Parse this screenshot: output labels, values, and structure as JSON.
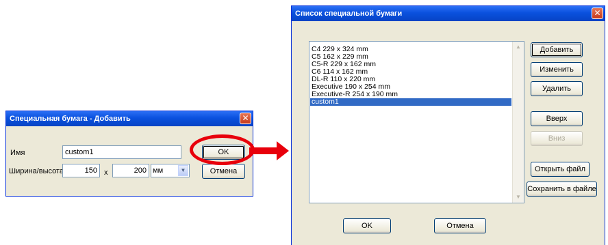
{
  "add_dialog": {
    "title": "Специальная бумага - Добавить",
    "close_glyph": "✕",
    "name_label": "Имя",
    "name_value": "custom1",
    "size_label": "Ширина/высота",
    "width_value": "150",
    "times_label": "x",
    "height_value": "200",
    "unit_value": "мм",
    "ok_label": "OK",
    "cancel_label": "Отмена"
  },
  "list_dialog": {
    "title": "Список специальной бумаги",
    "close_glyph": "✕",
    "items": [
      "C4 229 x 324 mm",
      "C5 162 x 229 mm",
      "C5-R 229 x 162 mm",
      "C6 114 x 162 mm",
      "DL-R 110 x 220 mm",
      "Executive 190 x 254 mm",
      "Executive-R 254 x 190 mm",
      "custom1"
    ],
    "selected_index": 7,
    "buttons": {
      "add": "Добавить",
      "edit": "Изменить",
      "delete": "Удалить",
      "up": "Вверх",
      "down": "Вниз",
      "open_file": "Открыть файл",
      "save_file": "Сохранить в файле"
    },
    "ok_label": "OK",
    "cancel_label": "Отмена"
  },
  "annotation": {
    "highlight_color": "#e8000b",
    "arrow_color": "#e8000b"
  }
}
